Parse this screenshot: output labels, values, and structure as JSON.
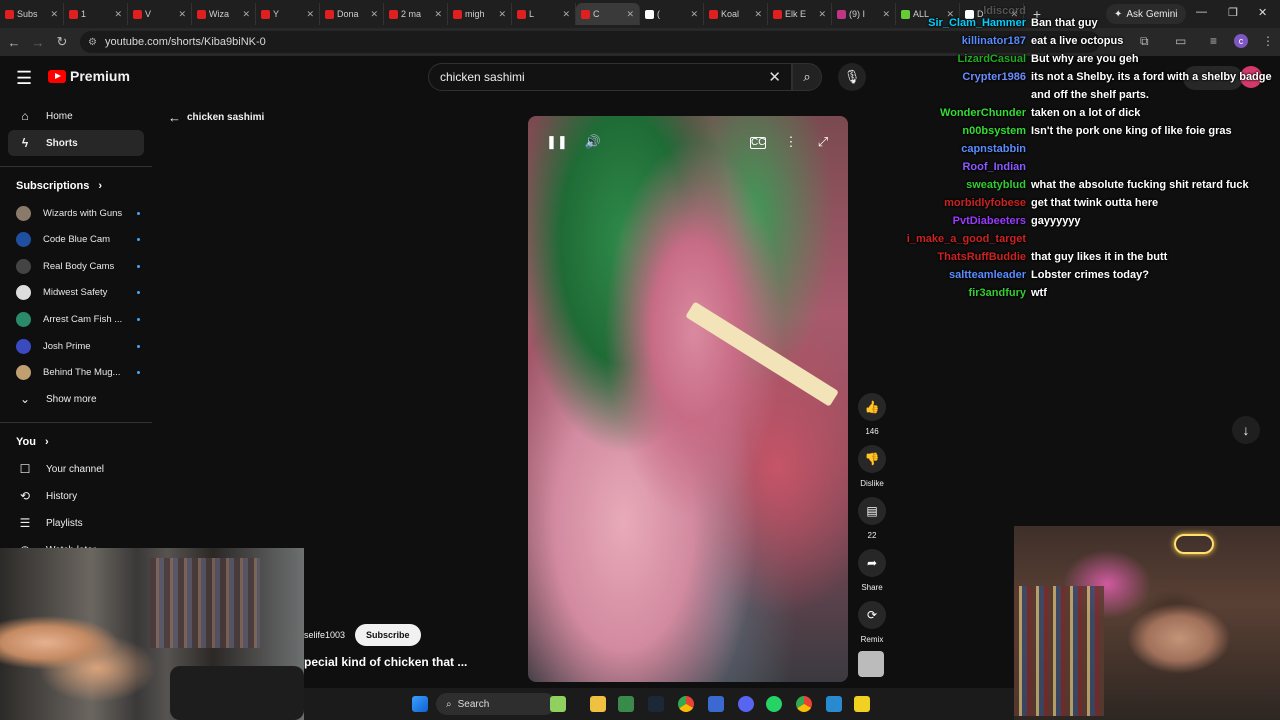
{
  "browser": {
    "tabs": [
      {
        "label": "Subs",
        "color": "#e02020"
      },
      {
        "label": "1",
        "color": "#e02020"
      },
      {
        "label": "V",
        "color": "#e02020"
      },
      {
        "label": "Wiza",
        "color": "#e02020"
      },
      {
        "label": "Y",
        "color": "#e02020"
      },
      {
        "label": "Dona",
        "color": "#e02020"
      },
      {
        "label": "2 ma",
        "color": "#e02020"
      },
      {
        "label": "migh",
        "color": "#e02020"
      },
      {
        "label": "L",
        "color": "#e02020"
      },
      {
        "label": "C",
        "color": "#e02020"
      },
      {
        "label": "(",
        "color": "#ffffff"
      },
      {
        "label": "Koal",
        "color": "#e02020"
      },
      {
        "label": "Elk E",
        "color": "#e02020"
      },
      {
        "label": "(9) I",
        "color": "#c13584"
      },
      {
        "label": "ALL",
        "color": "#66cc33"
      },
      {
        "label": "D",
        "color": "#ffffff"
      }
    ],
    "ask_gemini": "Ask Gemini",
    "url": "youtube.com/shorts/Kiba9biNK-0",
    "profile_letter": "c"
  },
  "yt": {
    "logo_text": "Premium",
    "search_value": "chicken sashimi",
    "back_query": "chicken sashimi",
    "sidebar": {
      "home": "Home",
      "shorts": "Shorts",
      "subscriptions_heading": "Subscriptions",
      "subscriptions": [
        {
          "name": "Wizards with Guns",
          "color": "#8a7a6a"
        },
        {
          "name": "Code Blue Cam",
          "color": "#1f4f9f"
        },
        {
          "name": "Real Body Cams",
          "color": "#444444"
        },
        {
          "name": "Midwest Safety",
          "color": "#dddddd"
        },
        {
          "name": "Arrest Cam Fish ...",
          "color": "#2a8a6a"
        },
        {
          "name": "Josh Prime",
          "color": "#3a4ac0"
        },
        {
          "name": "Behind The Mug...",
          "color": "#c0a070"
        }
      ],
      "show_more": "Show more",
      "you_heading": "You",
      "your_channel": "Your channel",
      "history": "History",
      "playlists": "Playlists",
      "watch_later": "Watch later"
    },
    "actions": {
      "likes": "146",
      "dislike": "Dislike",
      "comments": "22",
      "share": "Share",
      "remix": "Remix"
    },
    "channel": "selife1003",
    "subscribe": "Subscribe",
    "video_title": "pecial kind of chicken that ..."
  },
  "chat": {
    "top_partial": "ldiscord",
    "messages": [
      {
        "user": "Sir_Clam_Hammer",
        "color": "#00d0ff",
        "text": "Ban that guy"
      },
      {
        "user": "killinator187",
        "color": "#5a8cff",
        "text": "eat a live octopus"
      },
      {
        "user": "LizardCasual",
        "color": "#22aa22",
        "text": "But why are you geh"
      },
      {
        "user": "Crypter1986",
        "color": "#6a8cff",
        "text": "its not a Shelby. its a ford with a shelby badge"
      },
      {
        "user": "",
        "color": "#ffffff",
        "text": "and off the shelf parts."
      },
      {
        "user": "WonderChunder",
        "color": "#33dd33",
        "text": "taken on a lot of dick"
      },
      {
        "user": "n00bsystem",
        "color": "#33dd33",
        "text": "Isn't the pork one king of like foie gras"
      },
      {
        "user": "capnstabbin",
        "color": "#5a8cff",
        "text": ""
      },
      {
        "user": "Roof_Indian",
        "color": "#8a5aff",
        "text": ""
      },
      {
        "user": "sweatyblud",
        "color": "#33cc33",
        "text": "what the absolute fucking shit retard fuck"
      },
      {
        "user": "morbidlyfobese",
        "color": "#cc2222",
        "text": "get that twink outta here"
      },
      {
        "user": "PvtDiabeeters",
        "color": "#9a3aff",
        "text": "gayyyyyy"
      },
      {
        "user": "i_make_a_good_target",
        "color": "#cc2222",
        "text": ""
      },
      {
        "user": "ThatsRuffBuddie",
        "color": "#cc2222",
        "text": "that guy likes it in the butt"
      },
      {
        "user": "saltteamleader",
        "color": "#5a8cff",
        "text": "Lobster crimes today?"
      },
      {
        "user": "fir3andfury",
        "color": "#33cc33",
        "text": "wtf"
      }
    ]
  },
  "taskbar": {
    "search": "Search"
  }
}
